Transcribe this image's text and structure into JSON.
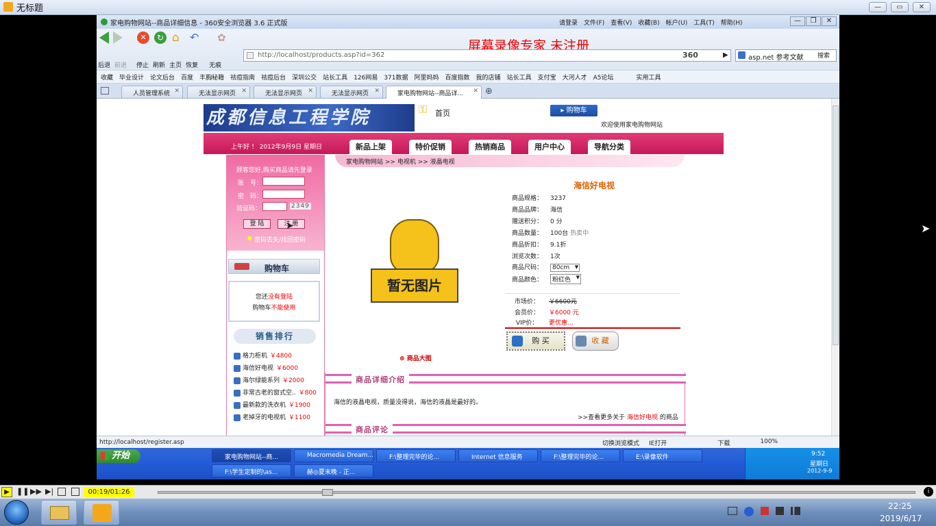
{
  "outer_window": {
    "title": "无标题"
  },
  "browser": {
    "title": "家电购物网站--商品详细信息 - 360安全浏览器 3.6 正式版",
    "watermark": "屏幕录像专家 未注册",
    "menus": [
      "请登录",
      "文件(F)",
      "查看(V)",
      "收藏(B)",
      "帐户(U)",
      "工具(T)",
      "帮助(H)"
    ],
    "nav_buttons": [
      "后退",
      "前进",
      "停止",
      "刷新",
      "主页",
      "恢复",
      "无痕"
    ],
    "address": "http://localhost/products.asp?id=362",
    "brand": "360",
    "search_value": "asp.net 参考文献",
    "search_button": "搜索",
    "bookmarks": [
      "收藏",
      "毕业设计",
      "论文后台",
      "百度",
      "丰胸秘籍",
      "祛痘指南",
      "祛痘后台",
      "深圳公交",
      "站长工具",
      "126网易",
      "371数据",
      "阿里妈妈",
      "百度指数",
      "我的店铺",
      "站长工具",
      "支付宝",
      "大河人才",
      "A5论坛",
      "实用工具"
    ],
    "tabs": [
      "人员管理系统",
      "无法显示网页",
      "无法显示网页",
      "无法显示网页",
      "家电购物网站--商品详..."
    ],
    "status_url": "http://localhost/register.asp",
    "status_right": [
      "切换浏览模式",
      "IE打开",
      "下载",
      "100%"
    ]
  },
  "site": {
    "logo_text": "成都信息工程学院",
    "home_link": "首页",
    "cart_button": "购物车",
    "welcome": "欢迎使用家电购物网站",
    "greeting": "上午好 ！ 2012年9月9日 星期日",
    "menu": [
      "新品上架",
      "特价促销",
      "热销商品",
      "用户中心",
      "导航分类"
    ],
    "breadcrumb": [
      "家电购物网站",
      "电视机",
      "液晶电视"
    ],
    "login": {
      "hint": "顾客您好,购买商品请先登录",
      "account_label": "账　号：",
      "password_label": "密　码：",
      "captcha_label": "验证码：",
      "captcha": "2349",
      "login_btn": "登 陆",
      "register_btn": "注 册",
      "forgot": "密码丢失/找回密码"
    },
    "cart": {
      "title": "购物车",
      "line1a": "您还",
      "line1b": "没有登陆",
      "line2a": "购物车",
      "line2b": "不能使用"
    },
    "rank": {
      "title": "销售排行",
      "items": [
        {
          "name": "格力柜机",
          "price": "￥4800"
        },
        {
          "name": "海信好电视",
          "price": "￥6000"
        },
        {
          "name": "海尔绿能系列",
          "price": "￥2000"
        },
        {
          "name": "非常古老的窗式空..",
          "price": "￥800"
        },
        {
          "name": "最新款的洗衣机",
          "price": "￥1900"
        },
        {
          "name": "老掉牙的电视机",
          "price": "￥1100"
        }
      ]
    },
    "product": {
      "image_text": "暂无图片",
      "big_image_link": "商品大图",
      "name": "海信好电视",
      "specs": [
        {
          "k": "商品规格：",
          "v": "3237"
        },
        {
          "k": "商品品牌：",
          "v": "海信"
        },
        {
          "k": "赠送积分：",
          "v": "0 分"
        },
        {
          "k": "商品数量：",
          "v": "100台",
          "extra": "热卖中"
        },
        {
          "k": "商品折扣：",
          "v": "9.1折"
        },
        {
          "k": "浏览次数：",
          "v": "1次"
        }
      ],
      "size_label": "商品尺码：",
      "size": "80cm",
      "color_label": "商品颜色：",
      "color": "粉红色",
      "market_label": "市场价：",
      "market_price": "￥6600元",
      "member_label": "会员价：",
      "member_price": "￥6000 元",
      "vip_label": "VIP价：",
      "vip_price": "更优惠...",
      "buy": "购 买",
      "fav": "收 藏"
    },
    "detail": {
      "title": "商品详细介绍",
      "text": "海信的液晶电视，质量没得说，海信的液晶是最好的。",
      "more_prefix": ">>查看更多关于",
      "more_name": "海信好电视",
      "more_suffix": "的商品"
    },
    "comment": {
      "title": "商品评论"
    }
  },
  "xp": {
    "start": "开始",
    "tasks": [
      "家电购物网站--商...",
      "Macromedia Dream...",
      "F:\\整理完毕的论...",
      "Internet 信息服务",
      "F:\\整理完毕的论...",
      "E:\\录像软件",
      "F:\\学生定制的\\as...",
      "赫◎夏末晚 - 正..."
    ],
    "clock": "9:52",
    "weekday": "星期日",
    "date": "2012-9-9"
  },
  "player": {
    "time": "00:19/01:26",
    "progress": 0.22
  },
  "win7": {
    "time": "22:25",
    "date": "2019/6/17"
  }
}
